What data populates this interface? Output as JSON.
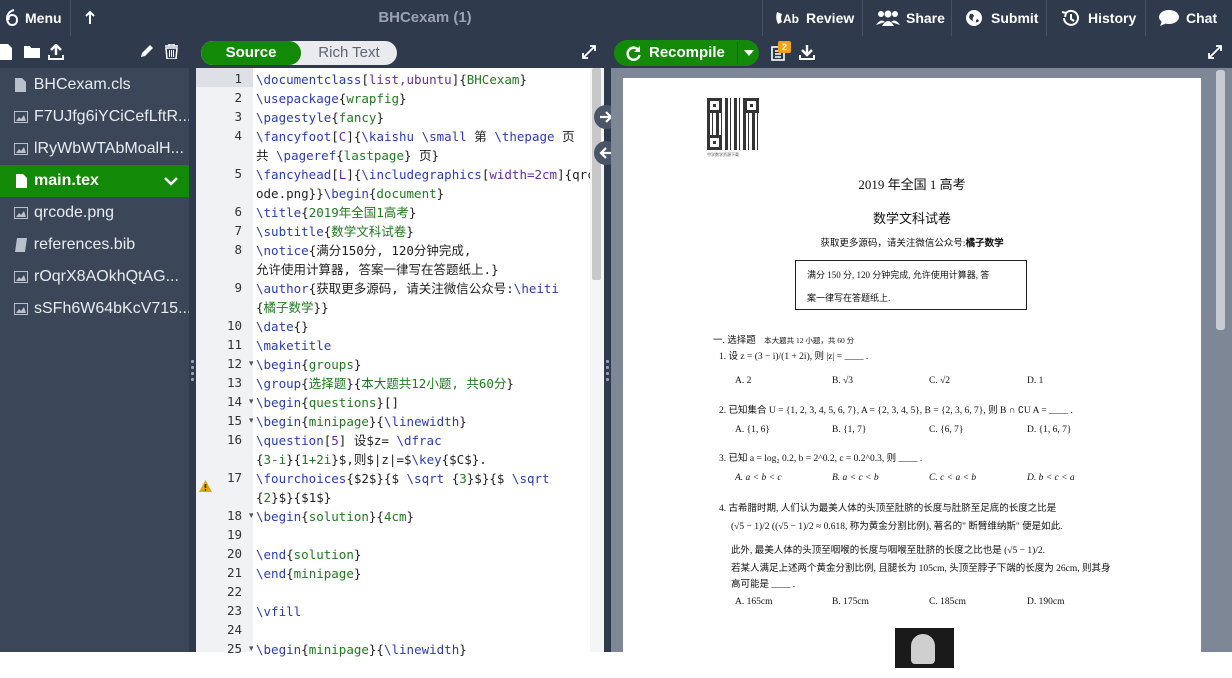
{
  "topbar": {
    "menu_label": "Menu",
    "title": "BHCexam (1)",
    "review_label": "Review",
    "share_label": "Share",
    "submit_label": "Submit",
    "history_label": "History",
    "chat_label": "Chat"
  },
  "files": [
    {
      "name": "BHCexam.cls",
      "icon": "file-icon"
    },
    {
      "name": "F7UJfg6iYCiCefLftR...",
      "icon": "image-icon"
    },
    {
      "name": "lRyWbWTAbMoalH...",
      "icon": "image-icon"
    },
    {
      "name": "main.tex",
      "icon": "file-icon",
      "active": true
    },
    {
      "name": "qrcode.png",
      "icon": "image-icon"
    },
    {
      "name": "references.bib",
      "icon": "book-icon"
    },
    {
      "name": "rOqrX8AOkhQtAG...",
      "icon": "image-icon"
    },
    {
      "name": "sSFh6W64bKcV715...",
      "icon": "image-icon"
    }
  ],
  "editor": {
    "source_label": "Source",
    "rich_label": "Rich Text",
    "line_numbers": [
      "1",
      "2",
      "3",
      "4",
      "",
      "5",
      "",
      "6",
      "7",
      "8",
      "",
      "9",
      "",
      "10",
      "11",
      "12",
      "13",
      "14",
      "15",
      "16",
      "",
      "17",
      "",
      "18",
      "19",
      "20",
      "21",
      "22",
      "23",
      "24",
      "25"
    ],
    "lines": [
      "\\documentclass[list,ubuntu]{BHCexam}",
      "\\usepackage{wrapfig}",
      "\\pagestyle{fancy}",
      "\\fancyfoot[C]{\\kaishu \\small 第 \\thepage 页",
      "共 \\pageref{lastpage} 页}",
      "\\fancyhead[L]{\\includegraphics[width=2cm]{qrc",
      "ode.png}}\\begin{document}",
      "\\title{2019年全国1高考}",
      "\\subtitle{数学文科试卷}",
      "\\notice{满分150分, 120分钟完成,",
      "允许使用计算器, 答案一律写在答题纸上.}",
      "\\author{获取更多源码, 请关注微信公众号:\\heiti",
      "{橘子数学}}",
      "\\date{}",
      "\\maketitle",
      "\\begin{groups}",
      "\\group{选择题}{本大题共12小题, 共60分}",
      "\\begin{questions}[]",
      "\\begin{minipage}{\\linewidth}",
      "\\question[5] 设$z= \\dfrac",
      "{3-i}{1+2i}$,则$|z|=$\\key{$C$}.",
      "\\fourchoices{$2$}{$ \\sqrt {3}$}{$ \\sqrt",
      "{2}$}{$1$}",
      "\\begin{solution}{4cm}",
      "",
      "\\end{solution}",
      "\\end{minipage}",
      "",
      "\\vfill",
      "",
      "\\begin{minipage}{\\linewidth}"
    ]
  },
  "pdf": {
    "recompile_label": "Recompile",
    "badge_count": "2",
    "title": "2019 年全国 1 高考",
    "subtitle": "数学文科试卷",
    "author_prefix": "获取更多源码，请关注微信公众号:",
    "author_name": "橘子数学",
    "notice_line1": "满分 150 分, 120 分钟完成, 允许使用计算器, 答",
    "notice_line2": "案一律写在答题纸上.",
    "section": "一. 选择题",
    "section_note": "本大题共 12 小题，共 60 分",
    "q1": "1.  设 z = (3 − i)/(1 + 2i), 则 |z| = ____ .",
    "q1_choices": [
      "A. 2",
      "B. √3",
      "C. √2",
      "D. 1"
    ],
    "q2": "2.  已知集合 U = {1, 2, 3, 4, 5, 6, 7}, A = {2, 3, 4, 5}, B = {2, 3, 6, 7}, 则 B ∩ ∁U A = ____ .",
    "q2_choices": [
      "A. {1, 6}",
      "B. {1, 7}",
      "C. {6, 7}",
      "D. {1, 6, 7}"
    ],
    "q3": "3.  已知 a = log₂ 0.2, b = 2^0.2, c = 0.2^0.3, 则 ____ .",
    "q3_choices": [
      "A. a < b < c",
      "B. a < c < b",
      "C. c < a < b",
      "D. b < c < a"
    ],
    "q4_line1": "4.  古希腊时期, 人们认为最美人体的头顶至肚脐的长度与肚脐至足底的长度之比是",
    "q4_line2": "(√5 − 1)/2 ((√5 − 1)/2 ≈ 0.618, 称为黄金分割比例), 著名的\" 断臂维纳斯\" 便是如此.",
    "q4_line3": "此外, 最美人体的头顶至咽喉的长度与咽喉至肚脐的长度之比也是 (√5 − 1)/2.",
    "q4_line4": "若某人满足上述两个黄金分割比例, 且腿长为 105cm, 头顶至脖子下端的长度为 26cm, 则其身",
    "q4_line5": "高可能是 ____ .",
    "q4_choices": [
      "A. 165cm",
      "B. 175cm",
      "C. 185cm",
      "D. 190cm"
    ],
    "qr_caption": "中学数学资源下载"
  },
  "colors": {
    "accent_green": "#138a07",
    "topbar_bg": "#2f3a4c",
    "sidebar_bg": "#3b4658"
  }
}
